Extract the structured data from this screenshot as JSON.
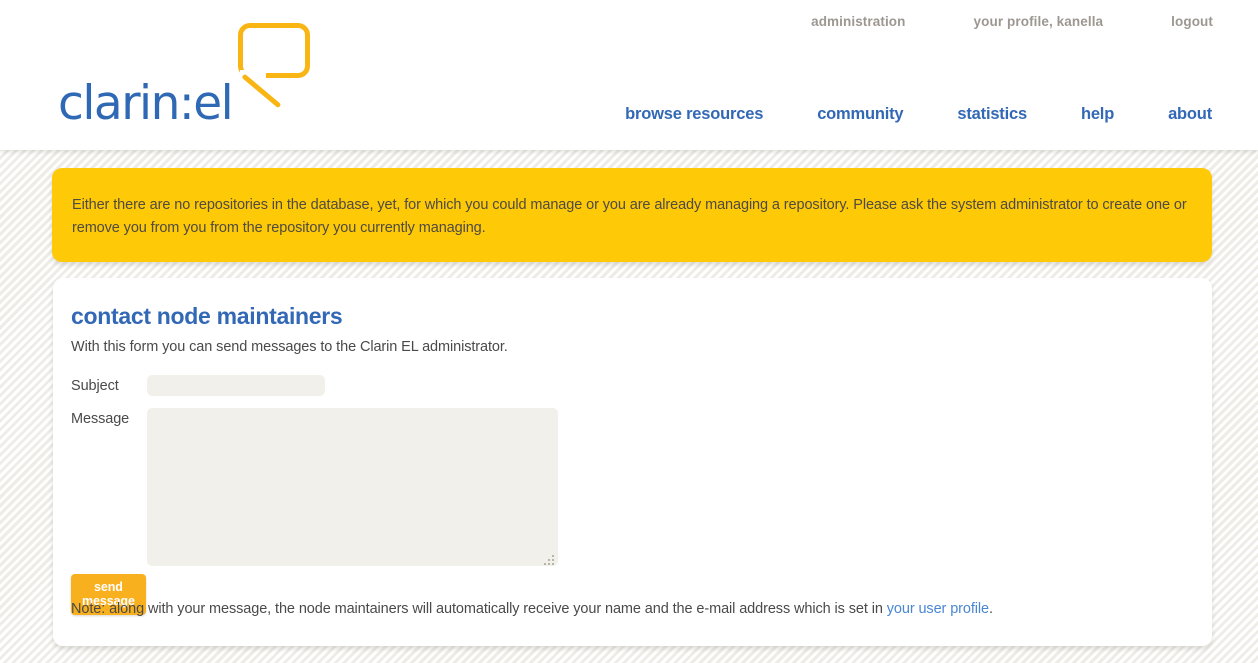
{
  "header": {
    "logo": {
      "text": "clarin:el",
      "icon": "speech-bubble-icon",
      "text_color": "#2f68b5",
      "bubble_color": "#f9b514"
    },
    "top_nav": [
      {
        "label": "administration"
      },
      {
        "label": "your profile, kanella"
      },
      {
        "label": "logout"
      }
    ],
    "main_nav": [
      {
        "label": "browse resources"
      },
      {
        "label": "community"
      },
      {
        "label": "statistics"
      },
      {
        "label": "help"
      },
      {
        "label": "about"
      }
    ]
  },
  "warning": {
    "text": "Either there are no repositories in the database, yet, for which you could manage or you are already managing a repository. Please ask the system administrator to create one or remove you from you from the repository you currently managing.",
    "background_color": "#fec907",
    "text_color": "#4f4a42"
  },
  "main": {
    "title": "contact node maintainers",
    "subtitle": "With this form you can send messages to the Clarin EL administrator.",
    "title_color": "#3268b5",
    "form": {
      "subject": {
        "label": "Subject",
        "value": "",
        "placeholder": ""
      },
      "message": {
        "label": "Message",
        "value": "",
        "placeholder": ""
      },
      "submit_label": "send message",
      "submit_color": "#f9b01e"
    },
    "note": {
      "prefix": "Note: along with your message, the node maintainers will automatically receive your name and the e-mail address which is set in ",
      "link_label": "your user profile",
      "suffix": ".",
      "link_color": "#4a86d4"
    }
  }
}
